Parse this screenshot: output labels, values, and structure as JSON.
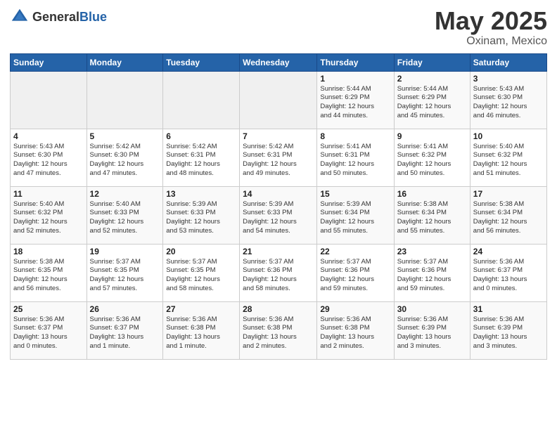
{
  "header": {
    "logo_general": "General",
    "logo_blue": "Blue",
    "month": "May 2025",
    "location": "Oxinam, Mexico"
  },
  "days_of_week": [
    "Sunday",
    "Monday",
    "Tuesday",
    "Wednesday",
    "Thursday",
    "Friday",
    "Saturday"
  ],
  "weeks": [
    [
      {
        "day": "",
        "info": ""
      },
      {
        "day": "",
        "info": ""
      },
      {
        "day": "",
        "info": ""
      },
      {
        "day": "",
        "info": ""
      },
      {
        "day": "1",
        "info": "Sunrise: 5:44 AM\nSunset: 6:29 PM\nDaylight: 12 hours\nand 44 minutes."
      },
      {
        "day": "2",
        "info": "Sunrise: 5:44 AM\nSunset: 6:29 PM\nDaylight: 12 hours\nand 45 minutes."
      },
      {
        "day": "3",
        "info": "Sunrise: 5:43 AM\nSunset: 6:30 PM\nDaylight: 12 hours\nand 46 minutes."
      }
    ],
    [
      {
        "day": "4",
        "info": "Sunrise: 5:43 AM\nSunset: 6:30 PM\nDaylight: 12 hours\nand 47 minutes."
      },
      {
        "day": "5",
        "info": "Sunrise: 5:42 AM\nSunset: 6:30 PM\nDaylight: 12 hours\nand 47 minutes."
      },
      {
        "day": "6",
        "info": "Sunrise: 5:42 AM\nSunset: 6:31 PM\nDaylight: 12 hours\nand 48 minutes."
      },
      {
        "day": "7",
        "info": "Sunrise: 5:42 AM\nSunset: 6:31 PM\nDaylight: 12 hours\nand 49 minutes."
      },
      {
        "day": "8",
        "info": "Sunrise: 5:41 AM\nSunset: 6:31 PM\nDaylight: 12 hours\nand 50 minutes."
      },
      {
        "day": "9",
        "info": "Sunrise: 5:41 AM\nSunset: 6:32 PM\nDaylight: 12 hours\nand 50 minutes."
      },
      {
        "day": "10",
        "info": "Sunrise: 5:40 AM\nSunset: 6:32 PM\nDaylight: 12 hours\nand 51 minutes."
      }
    ],
    [
      {
        "day": "11",
        "info": "Sunrise: 5:40 AM\nSunset: 6:32 PM\nDaylight: 12 hours\nand 52 minutes."
      },
      {
        "day": "12",
        "info": "Sunrise: 5:40 AM\nSunset: 6:33 PM\nDaylight: 12 hours\nand 52 minutes."
      },
      {
        "day": "13",
        "info": "Sunrise: 5:39 AM\nSunset: 6:33 PM\nDaylight: 12 hours\nand 53 minutes."
      },
      {
        "day": "14",
        "info": "Sunrise: 5:39 AM\nSunset: 6:33 PM\nDaylight: 12 hours\nand 54 minutes."
      },
      {
        "day": "15",
        "info": "Sunrise: 5:39 AM\nSunset: 6:34 PM\nDaylight: 12 hours\nand 55 minutes."
      },
      {
        "day": "16",
        "info": "Sunrise: 5:38 AM\nSunset: 6:34 PM\nDaylight: 12 hours\nand 55 minutes."
      },
      {
        "day": "17",
        "info": "Sunrise: 5:38 AM\nSunset: 6:34 PM\nDaylight: 12 hours\nand 56 minutes."
      }
    ],
    [
      {
        "day": "18",
        "info": "Sunrise: 5:38 AM\nSunset: 6:35 PM\nDaylight: 12 hours\nand 56 minutes."
      },
      {
        "day": "19",
        "info": "Sunrise: 5:37 AM\nSunset: 6:35 PM\nDaylight: 12 hours\nand 57 minutes."
      },
      {
        "day": "20",
        "info": "Sunrise: 5:37 AM\nSunset: 6:35 PM\nDaylight: 12 hours\nand 58 minutes."
      },
      {
        "day": "21",
        "info": "Sunrise: 5:37 AM\nSunset: 6:36 PM\nDaylight: 12 hours\nand 58 minutes."
      },
      {
        "day": "22",
        "info": "Sunrise: 5:37 AM\nSunset: 6:36 PM\nDaylight: 12 hours\nand 59 minutes."
      },
      {
        "day": "23",
        "info": "Sunrise: 5:37 AM\nSunset: 6:36 PM\nDaylight: 12 hours\nand 59 minutes."
      },
      {
        "day": "24",
        "info": "Sunrise: 5:36 AM\nSunset: 6:37 PM\nDaylight: 13 hours\nand 0 minutes."
      }
    ],
    [
      {
        "day": "25",
        "info": "Sunrise: 5:36 AM\nSunset: 6:37 PM\nDaylight: 13 hours\nand 0 minutes."
      },
      {
        "day": "26",
        "info": "Sunrise: 5:36 AM\nSunset: 6:37 PM\nDaylight: 13 hours\nand 1 minute."
      },
      {
        "day": "27",
        "info": "Sunrise: 5:36 AM\nSunset: 6:38 PM\nDaylight: 13 hours\nand 1 minute."
      },
      {
        "day": "28",
        "info": "Sunrise: 5:36 AM\nSunset: 6:38 PM\nDaylight: 13 hours\nand 2 minutes."
      },
      {
        "day": "29",
        "info": "Sunrise: 5:36 AM\nSunset: 6:38 PM\nDaylight: 13 hours\nand 2 minutes."
      },
      {
        "day": "30",
        "info": "Sunrise: 5:36 AM\nSunset: 6:39 PM\nDaylight: 13 hours\nand 3 minutes."
      },
      {
        "day": "31",
        "info": "Sunrise: 5:36 AM\nSunset: 6:39 PM\nDaylight: 13 hours\nand 3 minutes."
      }
    ]
  ]
}
